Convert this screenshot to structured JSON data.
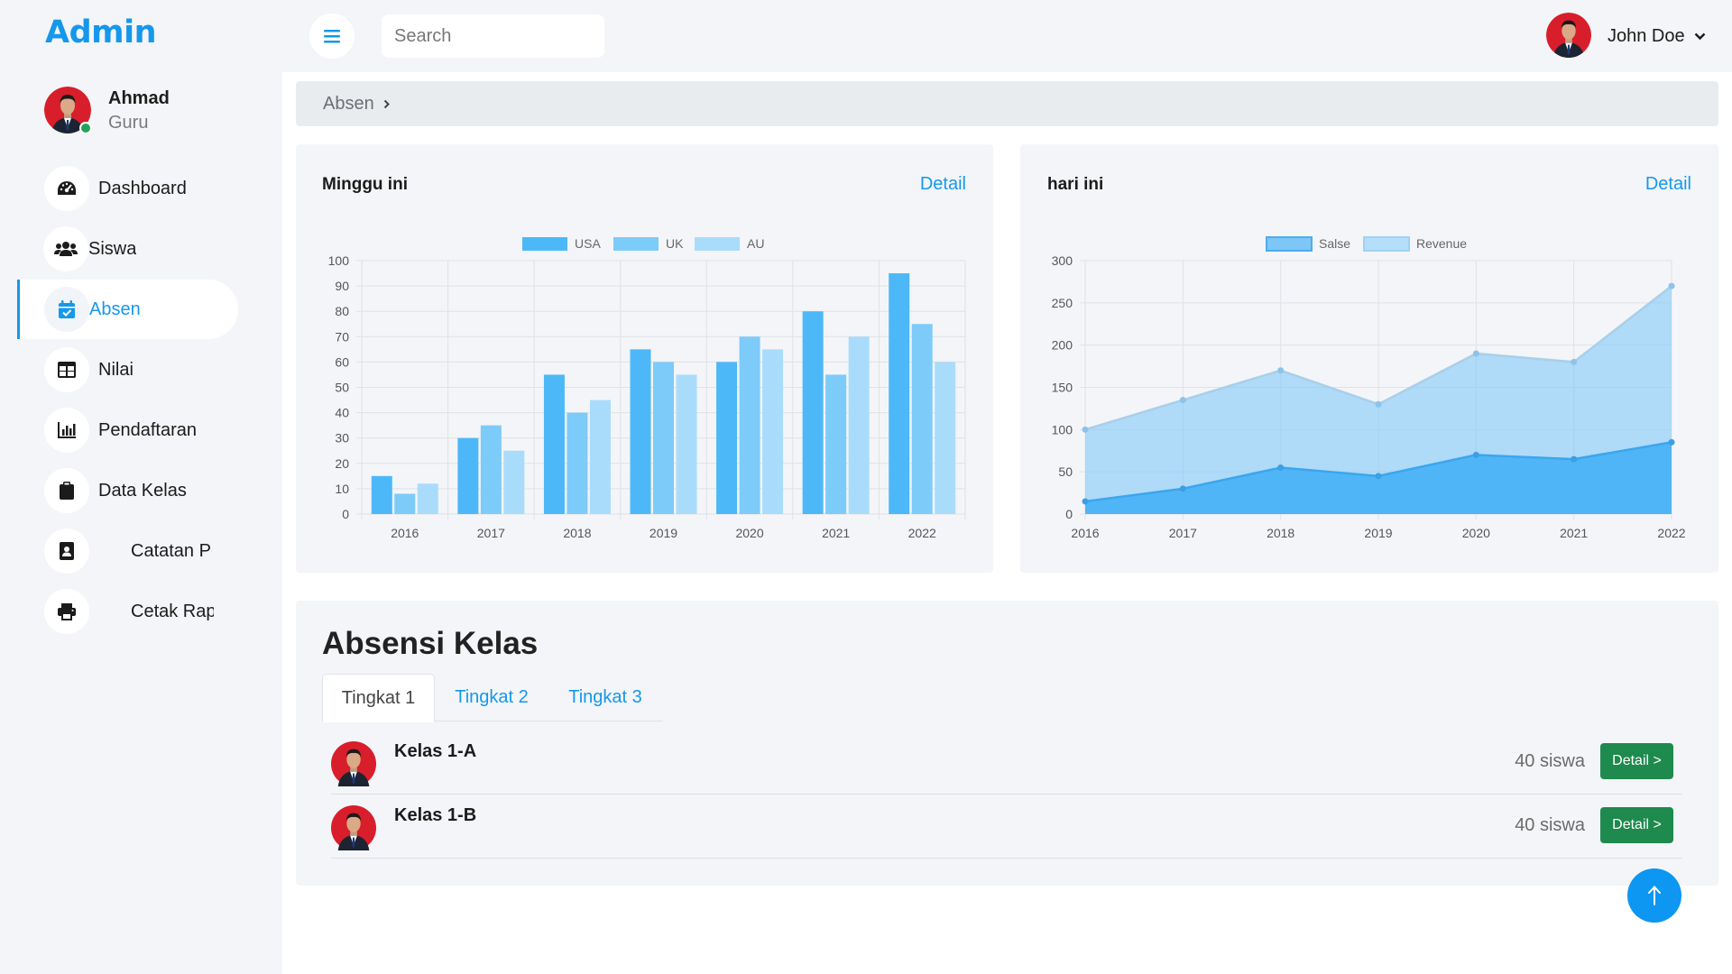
{
  "brand": "Admin",
  "profile": {
    "name": "Ahmad",
    "role": "Guru"
  },
  "sidebar": {
    "items": [
      {
        "label": "Dashboard",
        "icon": "tachometer-icon"
      },
      {
        "label": "Siswa",
        "icon": "users-icon"
      },
      {
        "label": "Absen",
        "icon": "calendar-check-icon",
        "active": true
      },
      {
        "label": "Nilai",
        "icon": "table-icon"
      },
      {
        "label": "Pendaftaran",
        "icon": "bar-chart-icon"
      },
      {
        "label": "Data Kelas",
        "icon": "clipboard-icon"
      },
      {
        "label": "Catatan Pe",
        "icon": "address-book-icon"
      },
      {
        "label": "Cetak Rap",
        "icon": "printer-icon"
      }
    ]
  },
  "topbar": {
    "search_placeholder": "Search",
    "user_name": "John Doe"
  },
  "breadcrumb": {
    "items": [
      "Absen"
    ]
  },
  "cards": {
    "weekly": {
      "title": "Minggu ini",
      "link": "Detail"
    },
    "today": {
      "title": "hari ini",
      "link": "Detail"
    }
  },
  "chart_data": [
    {
      "type": "bar",
      "title": "Minggu ini",
      "categories": [
        "2016",
        "2017",
        "2018",
        "2019",
        "2020",
        "2021",
        "2022"
      ],
      "series": [
        {
          "name": "USA",
          "color": "#4db8f8",
          "values": [
            15,
            30,
            55,
            65,
            60,
            80,
            95
          ]
        },
        {
          "name": "UK",
          "color": "#7dcbf9",
          "values": [
            8,
            35,
            40,
            60,
            70,
            55,
            75
          ]
        },
        {
          "name": "AU",
          "color": "#a9dcfb",
          "values": [
            12,
            25,
            45,
            55,
            65,
            70,
            60
          ]
        }
      ],
      "ylim": [
        0,
        100
      ],
      "yticks": [
        0,
        10,
        20,
        30,
        40,
        50,
        60,
        70,
        80,
        90,
        100
      ],
      "grid": true,
      "legend": "top-center"
    },
    {
      "type": "area",
      "title": "hari ini",
      "x": [
        "2016",
        "2017",
        "2018",
        "2019",
        "2020",
        "2021",
        "2022"
      ],
      "series": [
        {
          "name": "Salse",
          "color": "#4db8f8",
          "values": [
            15,
            30,
            55,
            45,
            70,
            65,
            85
          ]
        },
        {
          "name": "Revenue",
          "color": "#a9dcfb",
          "values": [
            100,
            135,
            170,
            130,
            190,
            180,
            270
          ]
        }
      ],
      "ylim": [
        0,
        300
      ],
      "yticks": [
        0,
        50,
        100,
        150,
        200,
        250,
        300
      ],
      "grid": true,
      "legend": "top-center"
    }
  ],
  "attendance": {
    "title": "Absensi Kelas",
    "tabs": [
      "Tingkat 1",
      "Tingkat 2",
      "Tingkat 3"
    ],
    "active_tab": 0,
    "classes": [
      {
        "name": "Kelas 1-A",
        "count": "40 siswa",
        "button": "Detail >"
      },
      {
        "name": "Kelas 1-B",
        "count": "40 siswa",
        "button": "Detail >"
      }
    ]
  },
  "colors": {
    "accent": "#1598eb",
    "success": "#1e8a4e",
    "avatar_bg": "#d81e2a"
  }
}
